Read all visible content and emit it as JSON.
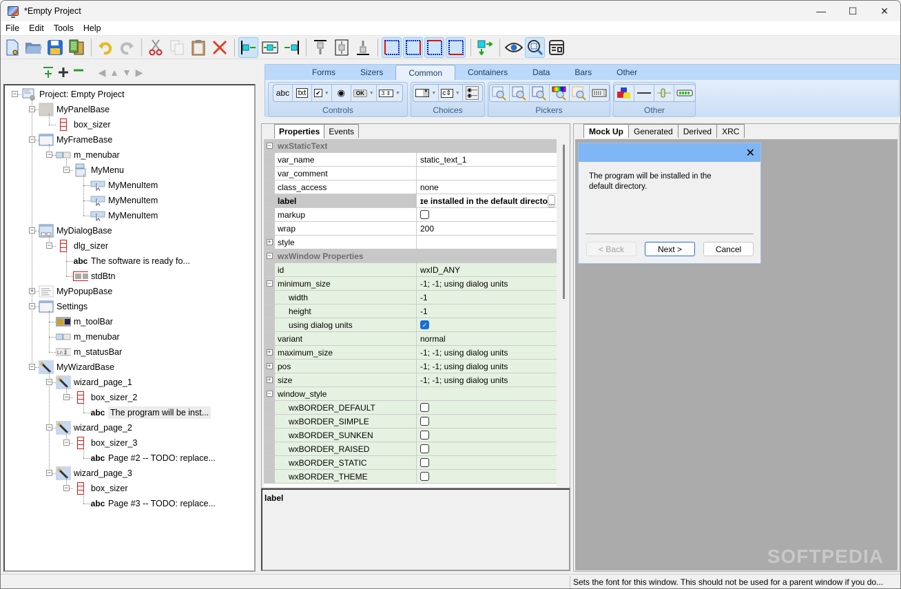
{
  "window": {
    "title": "*Empty Project",
    "controls": {
      "minimize": "—",
      "maximize": "☐",
      "close": "✕"
    }
  },
  "menubar": [
    "File",
    "Edit",
    "Tools",
    "Help"
  ],
  "toolbar": {
    "buttons": [
      {
        "name": "new-project-icon",
        "group": 1
      },
      {
        "name": "open-folder-icon",
        "group": 1
      },
      {
        "name": "save-icon",
        "group": 1
      },
      {
        "name": "generate-code-icon",
        "group": 1
      },
      {
        "name": "undo-icon",
        "group": 2
      },
      {
        "name": "redo-icon",
        "group": 2,
        "disabled": true
      },
      {
        "name": "cut-icon",
        "group": 3
      },
      {
        "name": "copy-icon",
        "group": 3,
        "disabled": true
      },
      {
        "name": "paste-icon",
        "group": 3
      },
      {
        "name": "delete-icon",
        "group": 3
      },
      {
        "name": "align-left-icon",
        "group": 4,
        "active": true
      },
      {
        "name": "align-center-h-icon",
        "group": 4
      },
      {
        "name": "align-right-icon",
        "group": 4
      },
      {
        "name": "align-top-icon",
        "group": 5
      },
      {
        "name": "align-center-v-icon",
        "group": 5
      },
      {
        "name": "align-bottom-icon",
        "group": 5
      },
      {
        "name": "border-left-icon",
        "group": 6,
        "active": true
      },
      {
        "name": "border-right-icon",
        "group": 6,
        "active": true
      },
      {
        "name": "border-top-icon",
        "group": 6,
        "active": true
      },
      {
        "name": "border-bottom-icon",
        "group": 6,
        "active": true
      },
      {
        "name": "expand-icon",
        "group": 7
      },
      {
        "name": "preview-eye-icon",
        "group": 8
      },
      {
        "name": "magnify-icon",
        "group": 8,
        "active": true
      },
      {
        "name": "form-layout-icon",
        "group": 8
      }
    ]
  },
  "tree_nav": {
    "buttons": [
      "add-sibling-icon",
      "add-child-icon",
      "remove-icon",
      "move-left-icon",
      "move-up-icon",
      "move-down-icon",
      "move-right-icon"
    ]
  },
  "tree": [
    {
      "label": "Project: Empty Project",
      "level": 0,
      "icon": "project-icon",
      "expander": "minus"
    },
    {
      "label": "MyPanelBase",
      "level": 1,
      "icon": "panel-icon",
      "expander": "minus"
    },
    {
      "label": "box_sizer",
      "level": 2,
      "icon": "sizer-icon"
    },
    {
      "label": "MyFrameBase",
      "level": 1,
      "icon": "frame-icon",
      "expander": "minus"
    },
    {
      "label": "m_menubar",
      "level": 2,
      "icon": "menubar-icon",
      "expander": "minus"
    },
    {
      "label": "MyMenu",
      "level": 3,
      "icon": "menu-icon",
      "expander": "minus"
    },
    {
      "label": "MyMenuItem",
      "level": 4,
      "icon": "menuitem-icon"
    },
    {
      "label": "MyMenuItem",
      "level": 4,
      "icon": "menuitem-icon"
    },
    {
      "label": "MyMenuItem",
      "level": 4,
      "icon": "menuitem-icon"
    },
    {
      "label": "MyDialogBase",
      "level": 1,
      "icon": "dialog-icon",
      "expander": "minus"
    },
    {
      "label": "dlg_sizer",
      "level": 2,
      "icon": "sizer-icon",
      "expander": "minus"
    },
    {
      "label": "The software is ready fo...",
      "level": 3,
      "icon": "static-text-icon"
    },
    {
      "label": "stdBtn",
      "level": 3,
      "icon": "std-button-icon"
    },
    {
      "label": "MyPopupBase",
      "level": 1,
      "icon": "popup-icon",
      "expander": "plus"
    },
    {
      "label": "Settings",
      "level": 1,
      "icon": "frame-icon",
      "expander": "minus"
    },
    {
      "label": "m_toolBar",
      "level": 2,
      "icon": "toolbar-icon"
    },
    {
      "label": "m_menubar",
      "level": 2,
      "icon": "menubar-icon"
    },
    {
      "label": "m_statusBar",
      "level": 2,
      "icon": "statusbar-icon"
    },
    {
      "label": "MyWizardBase",
      "level": 1,
      "icon": "wizard-icon",
      "expander": "minus"
    },
    {
      "label": "wizard_page_1",
      "level": 2,
      "icon": "wizard-icon",
      "expander": "minus"
    },
    {
      "label": "box_sizer_2",
      "level": 3,
      "icon": "sizer-icon",
      "expander": "minus"
    },
    {
      "label": "The program will be inst...",
      "level": 4,
      "icon": "static-text-icon",
      "selected": true
    },
    {
      "label": "wizard_page_2",
      "level": 2,
      "icon": "wizard-icon",
      "expander": "minus"
    },
    {
      "label": "box_sizer_3",
      "level": 3,
      "icon": "sizer-icon",
      "expander": "minus"
    },
    {
      "label": "Page #2 -- TODO: replace...",
      "level": 4,
      "icon": "static-text-icon"
    },
    {
      "label": "wizard_page_3",
      "level": 2,
      "icon": "wizard-icon",
      "expander": "minus"
    },
    {
      "label": "box_sizer",
      "level": 3,
      "icon": "sizer-icon",
      "expander": "minus"
    },
    {
      "label": "Page #3 -- TODO: replace...",
      "level": 4,
      "icon": "static-text-icon"
    }
  ],
  "palette": {
    "tabs": [
      "Forms",
      "Sizers",
      "Common",
      "Containers",
      "Data",
      "Bars",
      "Other"
    ],
    "active_tab": "Common",
    "groups": [
      {
        "label": "Controls",
        "items": [
          "abc",
          "txt",
          "checkbox",
          "radio",
          "OK",
          "spin"
        ]
      },
      {
        "label": "Choices",
        "items": [
          "combo",
          "choice",
          "radiobox"
        ]
      },
      {
        "label": "Pickers",
        "items": [
          "file-picker",
          "dir-picker",
          "font-picker",
          "color-picker",
          "date-picker",
          "time-picker"
        ]
      },
      {
        "label": "Other",
        "items": [
          "shapes",
          "static-line",
          "slider",
          "gauge"
        ]
      }
    ]
  },
  "properties": {
    "tabs": [
      "Properties",
      "Events"
    ],
    "active_tab": "Properties",
    "rows": [
      {
        "type": "cat",
        "name": "wxStaticText",
        "expander": "minus"
      },
      {
        "name": "var_name",
        "value": "static_text_1"
      },
      {
        "name": "var_comment",
        "value": ""
      },
      {
        "name": "class_access",
        "value": "none"
      },
      {
        "name": "label",
        "value": "ɪe installed in the default directo",
        "bold": true,
        "button": "..."
      },
      {
        "name": "markup",
        "checkbox": false
      },
      {
        "name": "wrap",
        "value": "200"
      },
      {
        "name": "style",
        "value": "",
        "expander": "plus"
      },
      {
        "type": "cat",
        "name": "wxWindow Properties",
        "expander": "minus"
      },
      {
        "name": "id",
        "value": "wxID_ANY",
        "green": true
      },
      {
        "name": "minimum_size",
        "value": "-1; -1; using dialog units",
        "green": true,
        "expander": "minus"
      },
      {
        "name": "width",
        "value": "-1",
        "green": true,
        "sub": true
      },
      {
        "name": "height",
        "value": "-1",
        "green": true,
        "sub": true
      },
      {
        "name": "using dialog units",
        "checkbox": true,
        "green": true,
        "sub": true
      },
      {
        "name": "variant",
        "value": "normal",
        "green": true
      },
      {
        "name": "maximum_size",
        "value": "-1; -1; using dialog units",
        "green": true,
        "expander": "plus"
      },
      {
        "name": "pos",
        "value": "-1; -1; using dialog units",
        "green": true,
        "expander": "plus"
      },
      {
        "name": "size",
        "value": "-1; -1; using dialog units",
        "green": true,
        "expander": "plus"
      },
      {
        "name": "window_style",
        "value": "",
        "green": true,
        "expander": "minus"
      },
      {
        "name": "wxBORDER_DEFAULT",
        "checkbox": false,
        "green": true,
        "sub": true
      },
      {
        "name": "wxBORDER_SIMPLE",
        "checkbox": false,
        "green": true,
        "sub": true
      },
      {
        "name": "wxBORDER_SUNKEN",
        "checkbox": false,
        "green": true,
        "sub": true
      },
      {
        "name": "wxBORDER_RAISED",
        "checkbox": false,
        "green": true,
        "sub": true
      },
      {
        "name": "wxBORDER_STATIC",
        "checkbox": false,
        "green": true,
        "sub": true
      },
      {
        "name": "wxBORDER_THEME",
        "checkbox": false,
        "green": true,
        "sub": true
      }
    ],
    "description_title": "label"
  },
  "mockup": {
    "tabs": [
      "Mock Up",
      "Generated",
      "Derived",
      "XRC"
    ],
    "active_tab": "Mock Up",
    "wizard": {
      "close": "✕",
      "text": "The program will be installed in the default directory.",
      "back": "< Back",
      "next": "Next >",
      "cancel": "Cancel"
    },
    "watermark": "SOFTPEDIA"
  },
  "statusbar": {
    "text": "Sets the font for this window. This should not be used for a parent window if you do..."
  },
  "colors": {
    "ribbon": "#c9dff7",
    "wizard_title": "#7fb6f5",
    "canvas": "#ababab",
    "green_row": "#e6f2e1",
    "sizer_red": "#e01010"
  }
}
